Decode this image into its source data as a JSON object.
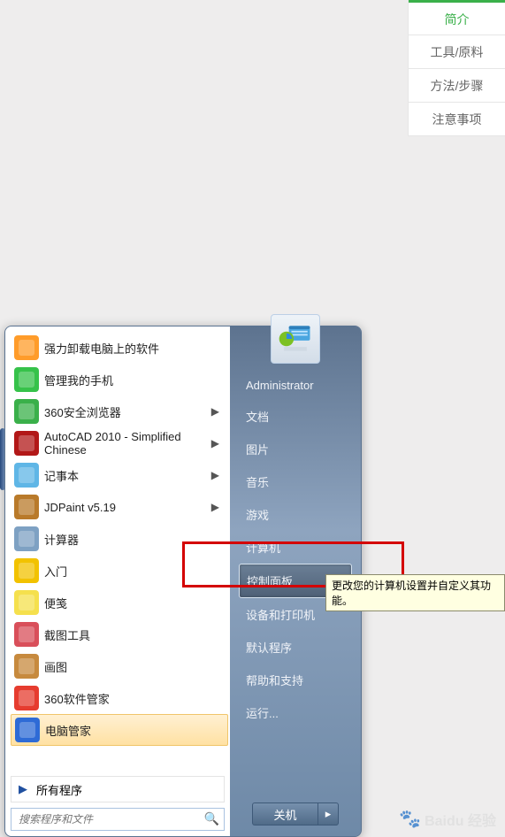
{
  "nav": {
    "items": [
      {
        "label": "简介",
        "active": true
      },
      {
        "label": "工具/原料"
      },
      {
        "label": "方法/步骤"
      },
      {
        "label": "注意事项"
      }
    ]
  },
  "start_menu": {
    "account_name": "Administrator",
    "left": [
      {
        "label": "强力卸载电脑上的软件",
        "icon": "uninstaller-icon",
        "color": "#ff9c2a"
      },
      {
        "label": "管理我的手机",
        "icon": "phone-manager-icon",
        "color": "#36c24a"
      },
      {
        "label": "360安全浏览器",
        "icon": "browser-360-icon",
        "color": "#3ab04a",
        "chevron": true
      },
      {
        "label": "AutoCAD 2010 - Simplified Chinese",
        "icon": "autocad-icon",
        "color": "#b21818",
        "chevron": true
      },
      {
        "label": "记事本",
        "icon": "notepad-icon",
        "color": "#5fb6e6",
        "chevron": true
      },
      {
        "label": "JDPaint v5.19",
        "icon": "jdpaint-icon",
        "color": "#b97a2a",
        "chevron": true
      },
      {
        "label": "计算器",
        "icon": "calculator-icon",
        "color": "#7ea1c3"
      },
      {
        "label": "入门",
        "icon": "getting-started-icon",
        "color": "#f2c200"
      },
      {
        "label": "便笺",
        "icon": "sticky-notes-icon",
        "color": "#f5e04d"
      },
      {
        "label": "截图工具",
        "icon": "snipping-tool-icon",
        "color": "#d94f5a"
      },
      {
        "label": "画图",
        "icon": "paint-icon",
        "color": "#c78a3e"
      },
      {
        "label": "360软件管家",
        "icon": "software-manager-icon",
        "color": "#e63c2f"
      },
      {
        "label": "电脑管家",
        "icon": "pc-manager-icon",
        "color": "#2e6bd6",
        "highlight": true
      }
    ],
    "all_programs": "所有程序",
    "search_placeholder": "搜索程序和文件",
    "right": [
      {
        "label": "Administrator"
      },
      {
        "label": "文档"
      },
      {
        "label": "图片"
      },
      {
        "label": "音乐"
      },
      {
        "label": "游戏"
      },
      {
        "label": "计算机"
      },
      {
        "label": "控制面板",
        "selected": true
      },
      {
        "label": "设备和打印机"
      },
      {
        "label": "默认程序"
      },
      {
        "label": "帮助和支持"
      },
      {
        "label": "运行..."
      }
    ],
    "shutdown_label": "关机",
    "tooltip_text": "更改您的计算机设置并自定义其功能。"
  },
  "watermark": "Baidu 经验"
}
